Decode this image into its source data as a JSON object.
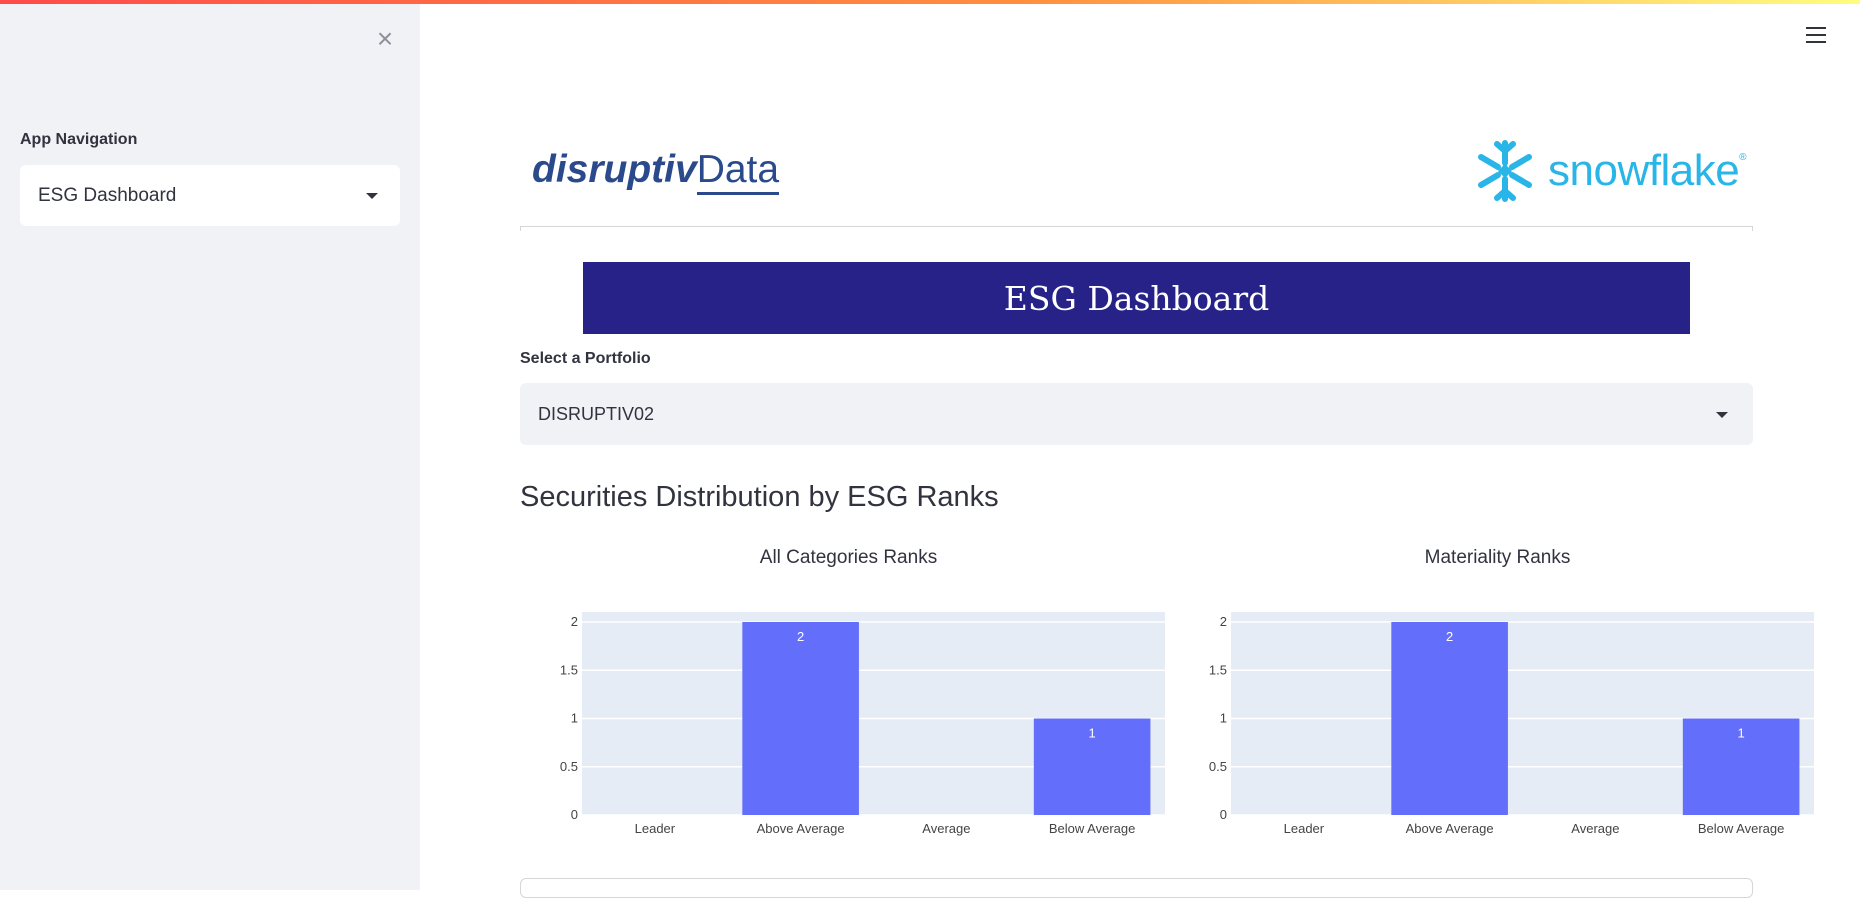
{
  "sidebar": {
    "close_icon": "×",
    "nav_label": "App Navigation",
    "nav_selected": "ESG Dashboard"
  },
  "header": {
    "menu_icon": "hamburger-menu",
    "logo_left_bold": "disruptiv",
    "logo_left_thin": "Data",
    "logo_right": "snowflake",
    "logo_right_reg": "®"
  },
  "main": {
    "banner_title": "ESG Dashboard",
    "portfolio_label": "Select a Portfolio",
    "portfolio_selected": "DISRUPTIV02",
    "section_title": "Securities Distribution by ESG Ranks"
  },
  "colors": {
    "banner": "#262288",
    "bar": "#636efa",
    "plot_bg": "#e5ecf6",
    "sidebar_bg": "#f0f2f6"
  },
  "chart_data": [
    {
      "type": "bar",
      "title": "All Categories Ranks",
      "categories": [
        "Leader",
        "Above Average",
        "Average",
        "Below Average"
      ],
      "values": [
        0,
        2,
        0,
        1
      ],
      "data_labels": [
        "",
        "2",
        "",
        "1"
      ],
      "ylim": [
        0,
        2
      ],
      "yticks": [
        0,
        0.5,
        1,
        1.5,
        2
      ],
      "ytick_labels": [
        "0",
        "0.5",
        "1",
        "1.5",
        "2"
      ],
      "xlabel": "",
      "ylabel": "",
      "grid": true
    },
    {
      "type": "bar",
      "title": "Materiality Ranks",
      "categories": [
        "Leader",
        "Above Average",
        "Average",
        "Below Average"
      ],
      "values": [
        0,
        2,
        0,
        1
      ],
      "data_labels": [
        "",
        "2",
        "",
        "1"
      ],
      "ylim": [
        0,
        2
      ],
      "yticks": [
        0,
        0.5,
        1,
        1.5,
        2
      ],
      "ytick_labels": [
        "0",
        "0.5",
        "1",
        "1.5",
        "2"
      ],
      "xlabel": "",
      "ylabel": "",
      "grid": true
    }
  ]
}
